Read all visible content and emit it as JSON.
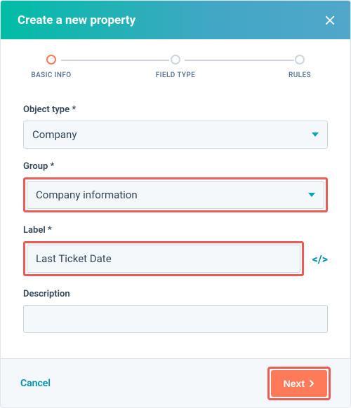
{
  "header": {
    "title": "Create a new property"
  },
  "stepper": {
    "steps": [
      {
        "label": "BASIC INFO"
      },
      {
        "label": "FIELD TYPE"
      },
      {
        "label": "RULES"
      }
    ]
  },
  "form": {
    "objectType": {
      "label": "Object type *",
      "value": "Company"
    },
    "group": {
      "label": "Group *",
      "value": "Company information"
    },
    "labelField": {
      "label": "Label *",
      "value": "Last Ticket Date"
    },
    "description": {
      "label": "Description",
      "value": ""
    }
  },
  "footer": {
    "cancel": "Cancel",
    "next": "Next"
  }
}
